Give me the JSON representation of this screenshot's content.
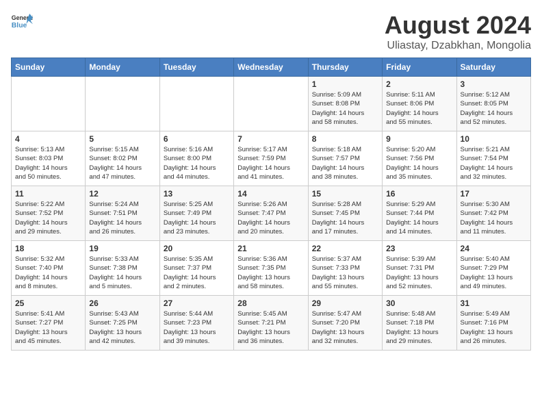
{
  "logo": {
    "line1": "General",
    "line2": "Blue"
  },
  "title": "August 2024",
  "subtitle": "Uliastay, Dzabkhan, Mongolia",
  "headers": [
    "Sunday",
    "Monday",
    "Tuesday",
    "Wednesday",
    "Thursday",
    "Friday",
    "Saturday"
  ],
  "weeks": [
    [
      {
        "day": "",
        "info": ""
      },
      {
        "day": "",
        "info": ""
      },
      {
        "day": "",
        "info": ""
      },
      {
        "day": "",
        "info": ""
      },
      {
        "day": "1",
        "info": "Sunrise: 5:09 AM\nSunset: 8:08 PM\nDaylight: 14 hours\nand 58 minutes."
      },
      {
        "day": "2",
        "info": "Sunrise: 5:11 AM\nSunset: 8:06 PM\nDaylight: 14 hours\nand 55 minutes."
      },
      {
        "day": "3",
        "info": "Sunrise: 5:12 AM\nSunset: 8:05 PM\nDaylight: 14 hours\nand 52 minutes."
      }
    ],
    [
      {
        "day": "4",
        "info": "Sunrise: 5:13 AM\nSunset: 8:03 PM\nDaylight: 14 hours\nand 50 minutes."
      },
      {
        "day": "5",
        "info": "Sunrise: 5:15 AM\nSunset: 8:02 PM\nDaylight: 14 hours\nand 47 minutes."
      },
      {
        "day": "6",
        "info": "Sunrise: 5:16 AM\nSunset: 8:00 PM\nDaylight: 14 hours\nand 44 minutes."
      },
      {
        "day": "7",
        "info": "Sunrise: 5:17 AM\nSunset: 7:59 PM\nDaylight: 14 hours\nand 41 minutes."
      },
      {
        "day": "8",
        "info": "Sunrise: 5:18 AM\nSunset: 7:57 PM\nDaylight: 14 hours\nand 38 minutes."
      },
      {
        "day": "9",
        "info": "Sunrise: 5:20 AM\nSunset: 7:56 PM\nDaylight: 14 hours\nand 35 minutes."
      },
      {
        "day": "10",
        "info": "Sunrise: 5:21 AM\nSunset: 7:54 PM\nDaylight: 14 hours\nand 32 minutes."
      }
    ],
    [
      {
        "day": "11",
        "info": "Sunrise: 5:22 AM\nSunset: 7:52 PM\nDaylight: 14 hours\nand 29 minutes."
      },
      {
        "day": "12",
        "info": "Sunrise: 5:24 AM\nSunset: 7:51 PM\nDaylight: 14 hours\nand 26 minutes."
      },
      {
        "day": "13",
        "info": "Sunrise: 5:25 AM\nSunset: 7:49 PM\nDaylight: 14 hours\nand 23 minutes."
      },
      {
        "day": "14",
        "info": "Sunrise: 5:26 AM\nSunset: 7:47 PM\nDaylight: 14 hours\nand 20 minutes."
      },
      {
        "day": "15",
        "info": "Sunrise: 5:28 AM\nSunset: 7:45 PM\nDaylight: 14 hours\nand 17 minutes."
      },
      {
        "day": "16",
        "info": "Sunrise: 5:29 AM\nSunset: 7:44 PM\nDaylight: 14 hours\nand 14 minutes."
      },
      {
        "day": "17",
        "info": "Sunrise: 5:30 AM\nSunset: 7:42 PM\nDaylight: 14 hours\nand 11 minutes."
      }
    ],
    [
      {
        "day": "18",
        "info": "Sunrise: 5:32 AM\nSunset: 7:40 PM\nDaylight: 14 hours\nand 8 minutes."
      },
      {
        "day": "19",
        "info": "Sunrise: 5:33 AM\nSunset: 7:38 PM\nDaylight: 14 hours\nand 5 minutes."
      },
      {
        "day": "20",
        "info": "Sunrise: 5:35 AM\nSunset: 7:37 PM\nDaylight: 14 hours\nand 2 minutes."
      },
      {
        "day": "21",
        "info": "Sunrise: 5:36 AM\nSunset: 7:35 PM\nDaylight: 13 hours\nand 58 minutes."
      },
      {
        "day": "22",
        "info": "Sunrise: 5:37 AM\nSunset: 7:33 PM\nDaylight: 13 hours\nand 55 minutes."
      },
      {
        "day": "23",
        "info": "Sunrise: 5:39 AM\nSunset: 7:31 PM\nDaylight: 13 hours\nand 52 minutes."
      },
      {
        "day": "24",
        "info": "Sunrise: 5:40 AM\nSunset: 7:29 PM\nDaylight: 13 hours\nand 49 minutes."
      }
    ],
    [
      {
        "day": "25",
        "info": "Sunrise: 5:41 AM\nSunset: 7:27 PM\nDaylight: 13 hours\nand 45 minutes."
      },
      {
        "day": "26",
        "info": "Sunrise: 5:43 AM\nSunset: 7:25 PM\nDaylight: 13 hours\nand 42 minutes."
      },
      {
        "day": "27",
        "info": "Sunrise: 5:44 AM\nSunset: 7:23 PM\nDaylight: 13 hours\nand 39 minutes."
      },
      {
        "day": "28",
        "info": "Sunrise: 5:45 AM\nSunset: 7:21 PM\nDaylight: 13 hours\nand 36 minutes."
      },
      {
        "day": "29",
        "info": "Sunrise: 5:47 AM\nSunset: 7:20 PM\nDaylight: 13 hours\nand 32 minutes."
      },
      {
        "day": "30",
        "info": "Sunrise: 5:48 AM\nSunset: 7:18 PM\nDaylight: 13 hours\nand 29 minutes."
      },
      {
        "day": "31",
        "info": "Sunrise: 5:49 AM\nSunset: 7:16 PM\nDaylight: 13 hours\nand 26 minutes."
      }
    ]
  ]
}
